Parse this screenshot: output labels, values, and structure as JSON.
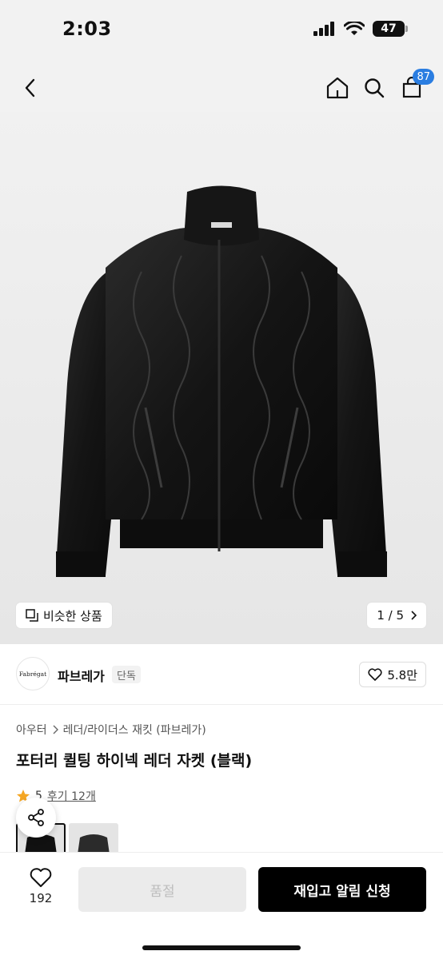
{
  "status_bar": {
    "time": "2:03",
    "battery": "47"
  },
  "header": {
    "cart_count": "87"
  },
  "gallery": {
    "similar_label": "비슷한 상품",
    "page_indicator": "1 / 5"
  },
  "brand": {
    "logo_text": "Fabrégat",
    "name": "파브레가",
    "tag": "단독",
    "likes": "5.8만"
  },
  "breadcrumb": {
    "category": "아우터",
    "subcategory": "레더/라이더스 재킷 (파브레가)"
  },
  "product": {
    "title": "포터리 퀼팅 하이넥 레더 자켓 (블랙)"
  },
  "rating": {
    "score": "5",
    "reviews": "후기 12개"
  },
  "bottom": {
    "wish_count": "192",
    "soldout_label": "품절",
    "restock_label": "재입고 알림 신청"
  },
  "colors": {
    "badge": "#2a7de1",
    "star": "#f5a623",
    "primary_button": "#000000"
  }
}
